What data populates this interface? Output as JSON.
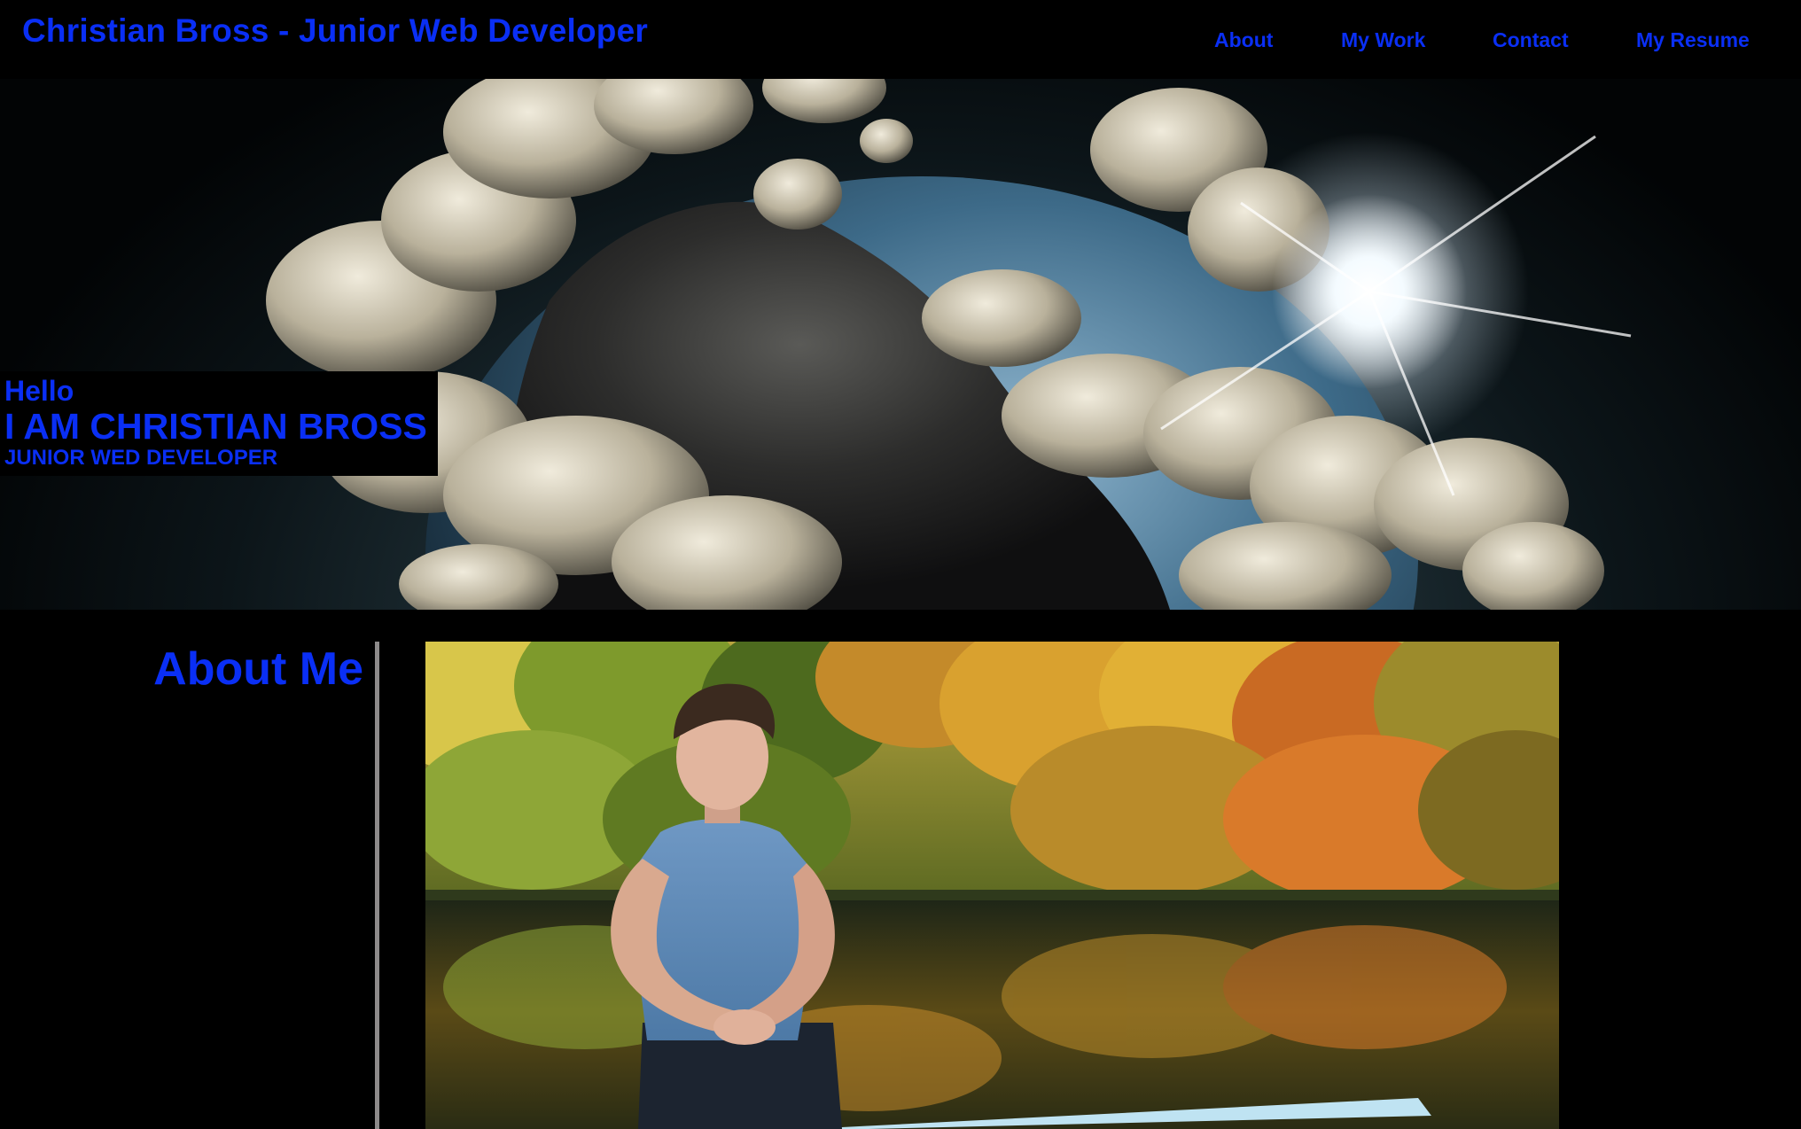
{
  "header": {
    "title": "Christian Bross - Junior Web Developer",
    "nav": [
      {
        "label": "About"
      },
      {
        "label": "My Work"
      },
      {
        "label": "Contact"
      },
      {
        "label": "My Resume"
      }
    ]
  },
  "hero": {
    "greeting": "Hello",
    "name": "I AM CHRISTIAN BROSS",
    "role": "JUNIOR WED DEVELOPER"
  },
  "about": {
    "title": "About Me"
  },
  "colors": {
    "accent": "#0a2ff5",
    "background": "#000000",
    "divider": "#8d8a8a"
  }
}
